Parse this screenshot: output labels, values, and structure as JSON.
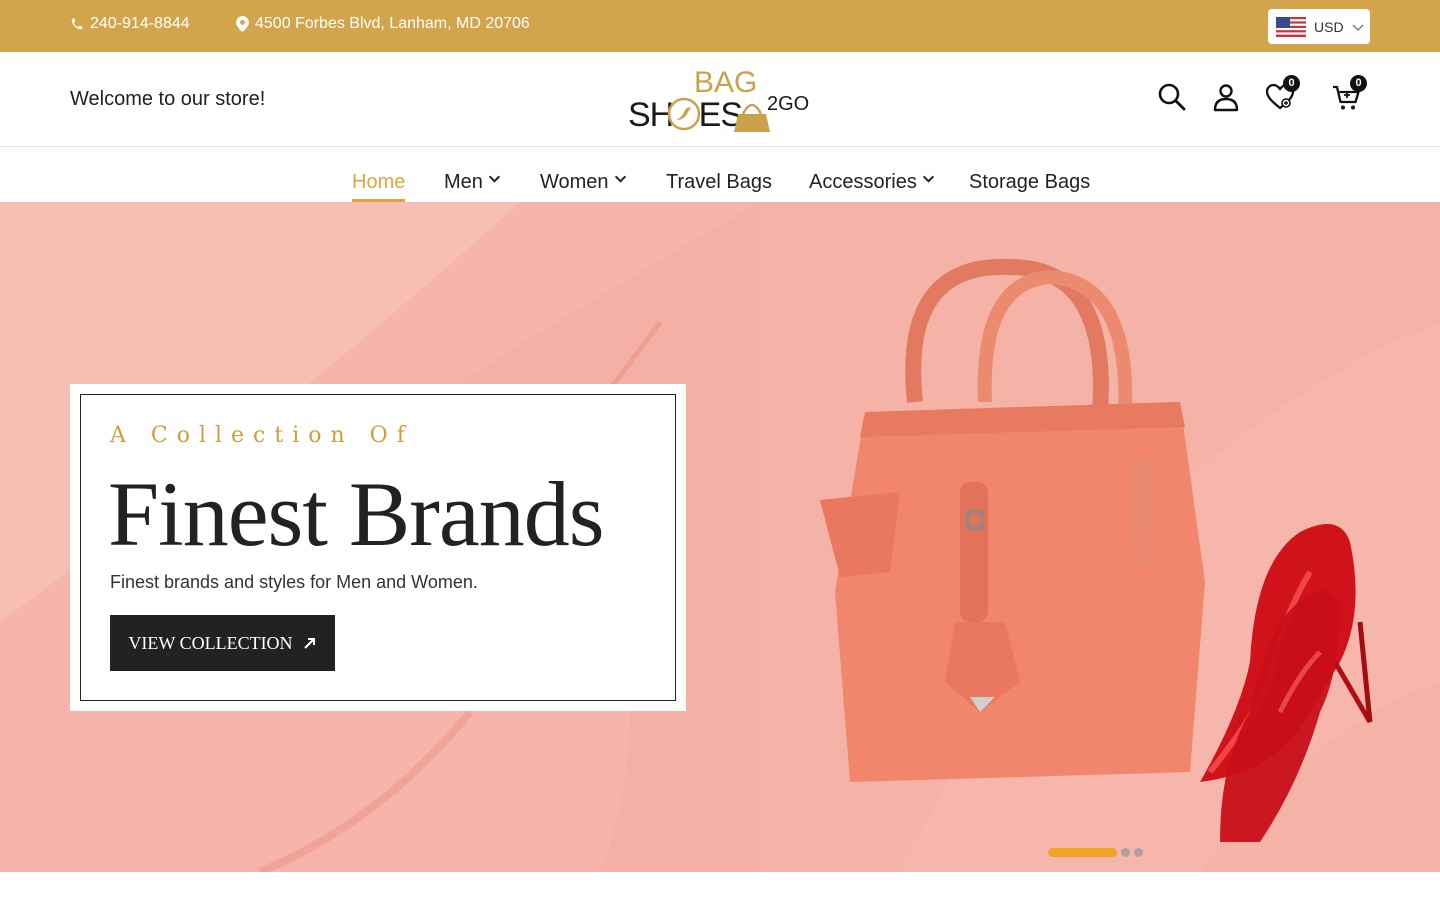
{
  "topbar": {
    "phone": "240-914-8844",
    "address": "4500 Forbes Blvd, Lanham, MD 20706",
    "currency": "USD",
    "phone_icon": "phone-icon",
    "address_icon": "map-pin-icon",
    "flag_icon": "us-flag-icon"
  },
  "header": {
    "welcome": "Welcome to our store!",
    "logo": {
      "line1": "BAG",
      "line2": "SHOES",
      "suffix": "2GO"
    },
    "wishlist_count": "0",
    "cart_count": "0"
  },
  "nav": {
    "items": [
      {
        "label": "Home",
        "active": true
      },
      {
        "label": "Men",
        "dropdown": true
      },
      {
        "label": "Women",
        "dropdown": true
      },
      {
        "label": "Travel Bags"
      },
      {
        "label": "Accessories",
        "dropdown": true
      },
      {
        "label": "Storage Bags"
      }
    ]
  },
  "hero": {
    "kicker": "A Collection Of",
    "headline": "Finest Brands",
    "subtext": "Finest brands and styles for Men and Women.",
    "cta_label": "VIEW COLLECTION",
    "slides": 3,
    "active_slide": 1
  },
  "colors": {
    "topbar": "#d2a54c",
    "accent": "#e8a23a",
    "hero_bg": "#f6b2a8",
    "button": "#222222"
  }
}
